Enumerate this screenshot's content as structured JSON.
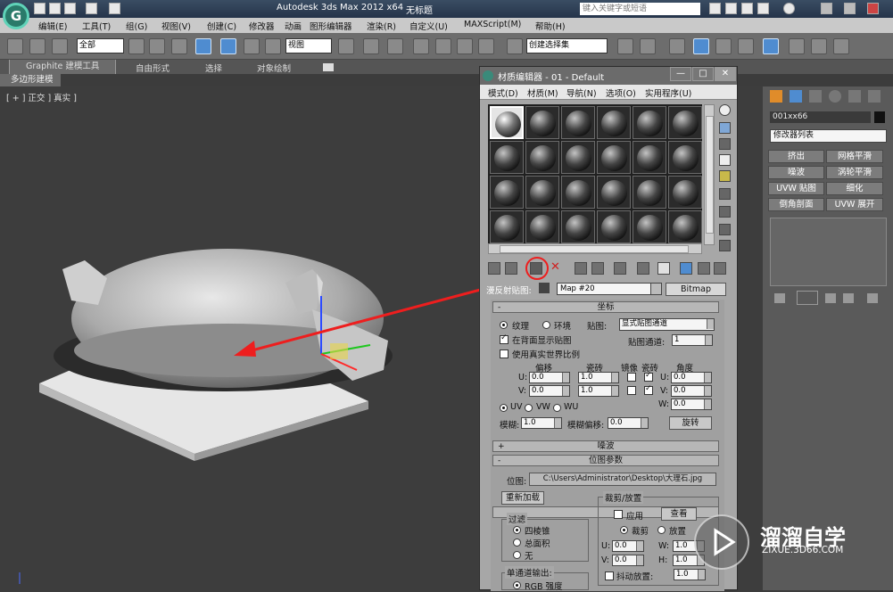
{
  "titlebar": {
    "app_title": "Autodesk 3ds Max  2012 x64",
    "doc_title": "无标题",
    "search_placeholder": "键入关键字或短语"
  },
  "menubar": {
    "items": [
      "编辑(E)",
      "工具(T)",
      "组(G)",
      "视图(V)",
      "创建(C)",
      "修改器",
      "动画",
      "图形编辑器",
      "渲染(R)",
      "自定义(U)",
      "MAXScript(M)",
      "帮助(H)"
    ]
  },
  "toolbar": {
    "selection_filter": "全部",
    "ref_coord": "视图",
    "named_selection": "创建选择集"
  },
  "ribbon": {
    "tabs": [
      "Graphite 建模工具",
      "自由形式",
      "选择",
      "对象绘制"
    ],
    "subtab": "多边形建模"
  },
  "viewport": {
    "label": "[ + ] 正交 ] 真实 ]"
  },
  "material_editor": {
    "title": "材质编辑器 - 01 - Default",
    "window_buttons": [
      "—",
      "□",
      "✕"
    ],
    "menu": [
      "模式(D)",
      "材质(M)",
      "导航(N)",
      "选项(O)",
      "实用程序(U)"
    ],
    "map_label": "漫反射贴图:",
    "map_name": "Map #20",
    "map_type": "Bitmap",
    "coords": {
      "header": "坐标",
      "tex_label": "纹理",
      "env_label": "环境",
      "mapping_label": "贴图:",
      "mapping_value": "显式贴图通道",
      "show_back": "在背面显示贴图",
      "map_channel_label": "贴图通道:",
      "map_channel_value": "1",
      "real_world": "使用真实世界比例",
      "offset_label": "偏移",
      "tiling_label": "瓷砖",
      "mirror_label": "镜像",
      "tile_label": "瓷砖",
      "angle_label": "角度",
      "u_label": "U:",
      "v_label": "V:",
      "w_label": "W:",
      "u_offset": "0.0",
      "v_offset": "0.0",
      "u_tiling": "1.0",
      "v_tiling": "1.0",
      "u_angle": "0.0",
      "v_angle": "0.0",
      "w_angle": "0.0",
      "uv": "UV",
      "vw": "VW",
      "wu": "WU",
      "blur_label": "模糊:",
      "blur_value": "1.0",
      "blur_offset_label": "模糊偏移:",
      "blur_offset_value": "0.0",
      "rotate": "旋转"
    },
    "noise_header": "噪波",
    "bitmap": {
      "header": "位图参数",
      "path_label": "位图:",
      "path_value": "C:\\Users\\Administrator\\Desktop\\大理石.jpg",
      "reload": "重新加载",
      "crop_group": "裁剪/放置",
      "apply": "应用",
      "view_image": "查看",
      "crop": "裁剪",
      "place": "放置",
      "u_label": "U:",
      "v_label": "V:",
      "w_label": "W:",
      "h_label": "H:",
      "u_value": "0.0",
      "v_value": "0.0",
      "w_value": "1.0",
      "h_value": "1.0",
      "jitter": "抖动放置:",
      "jitter_value": "1.0",
      "filter_group": "过滤",
      "filter_opts": [
        "四棱锥",
        "总面积",
        "无"
      ],
      "mono_group": "单通道输出:",
      "rgb_intensity": "RGB 强度"
    }
  },
  "command_panel": {
    "object_name": "001xx66",
    "modifier_list": "修改器列表",
    "buttons": [
      "挤出",
      "网格平滑",
      "噪波",
      "涡轮平滑",
      "UVW 贴图",
      "细化",
      "倒角剖面",
      "UVW 展开"
    ]
  },
  "watermark": {
    "title": "溜溜自学",
    "url": "ZIXUE.3D66.COM"
  },
  "colors": {
    "annotation_red": "#ee1e1e",
    "viewport_bg": "#3d3d3d",
    "title_blue": "#2a3d55"
  }
}
